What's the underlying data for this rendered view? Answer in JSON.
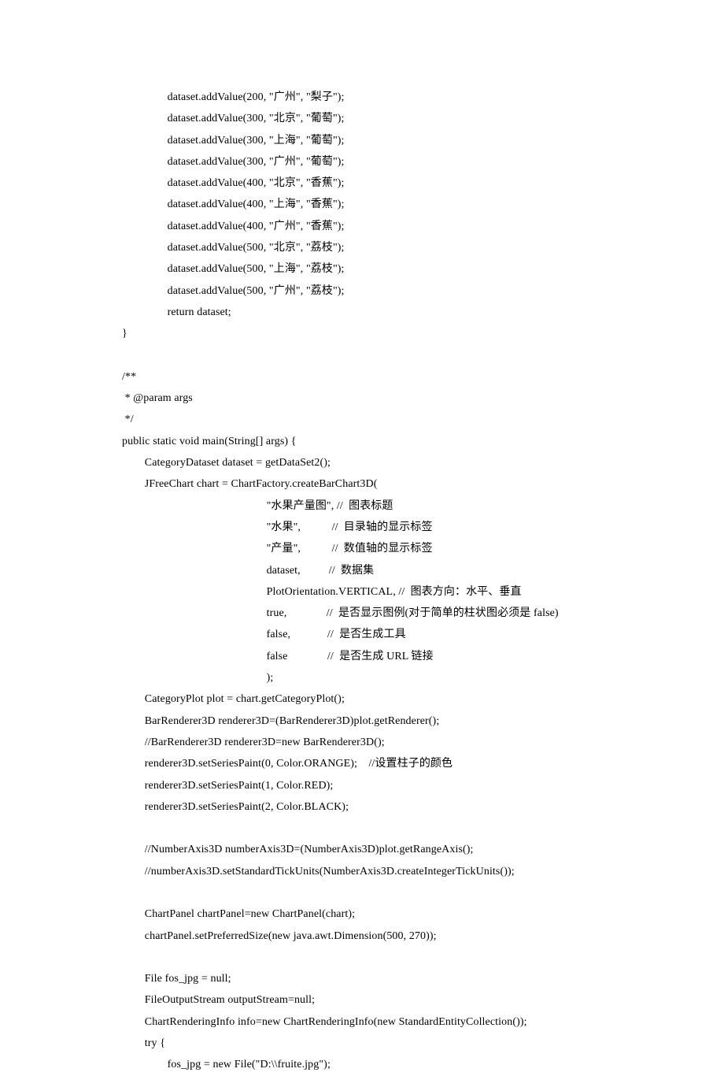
{
  "code": {
    "lines": [
      "                dataset.addValue(200, \"广州\", \"梨子\");",
      "                dataset.addValue(300, \"北京\", \"葡萄\");",
      "                dataset.addValue(300, \"上海\", \"葡萄\");",
      "                dataset.addValue(300, \"广州\", \"葡萄\");",
      "                dataset.addValue(400, \"北京\", \"香蕉\");",
      "                dataset.addValue(400, \"上海\", \"香蕉\");",
      "                dataset.addValue(400, \"广州\", \"香蕉\");",
      "                dataset.addValue(500, \"北京\", \"荔枝\");",
      "                dataset.addValue(500, \"上海\", \"荔枝\");",
      "                dataset.addValue(500, \"广州\", \"荔枝\");",
      "                return dataset;",
      "}",
      "",
      "/**",
      " * @param args",
      " */",
      "public static void main(String[] args) {",
      "        CategoryDataset dataset = getDataSet2();",
      "        JFreeChart chart = ChartFactory.createBarChart3D(",
      "                                                   \"水果产量图\", //  图表标题",
      "                                                   \"水果\",           //  目录轴的显示标签",
      "                                                   \"产量\",           //  数值轴的显示标签",
      "                                                   dataset,          //  数据集",
      "                                                   PlotOrientation.VERTICAL, //  图表方向：水平、垂直",
      "                                                   true,              //  是否显示图例(对于简单的柱状图必须是 false)",
      "                                                   false,             //  是否生成工具",
      "                                                   false              //  是否生成 URL 链接",
      "                                                   );",
      "        CategoryPlot plot = chart.getCategoryPlot();",
      "        BarRenderer3D renderer3D=(BarRenderer3D)plot.getRenderer();",
      "        //BarRenderer3D renderer3D=new BarRenderer3D();",
      "        renderer3D.setSeriesPaint(0, Color.ORANGE);    //设置柱子的颜色",
      "        renderer3D.setSeriesPaint(1, Color.RED);",
      "        renderer3D.setSeriesPaint(2, Color.BLACK);",
      "",
      "        //NumberAxis3D numberAxis3D=(NumberAxis3D)plot.getRangeAxis();",
      "        //numberAxis3D.setStandardTickUnits(NumberAxis3D.createIntegerTickUnits());",
      "",
      "        ChartPanel chartPanel=new ChartPanel(chart);",
      "        chartPanel.setPreferredSize(new java.awt.Dimension(500, 270));",
      "",
      "        File fos_jpg = null;",
      "        FileOutputStream outputStream=null;",
      "        ChartRenderingInfo info=new ChartRenderingInfo(new StandardEntityCollection());",
      "        try {",
      "                fos_jpg = new File(\"D:\\\\fruite.jpg\");"
    ]
  }
}
